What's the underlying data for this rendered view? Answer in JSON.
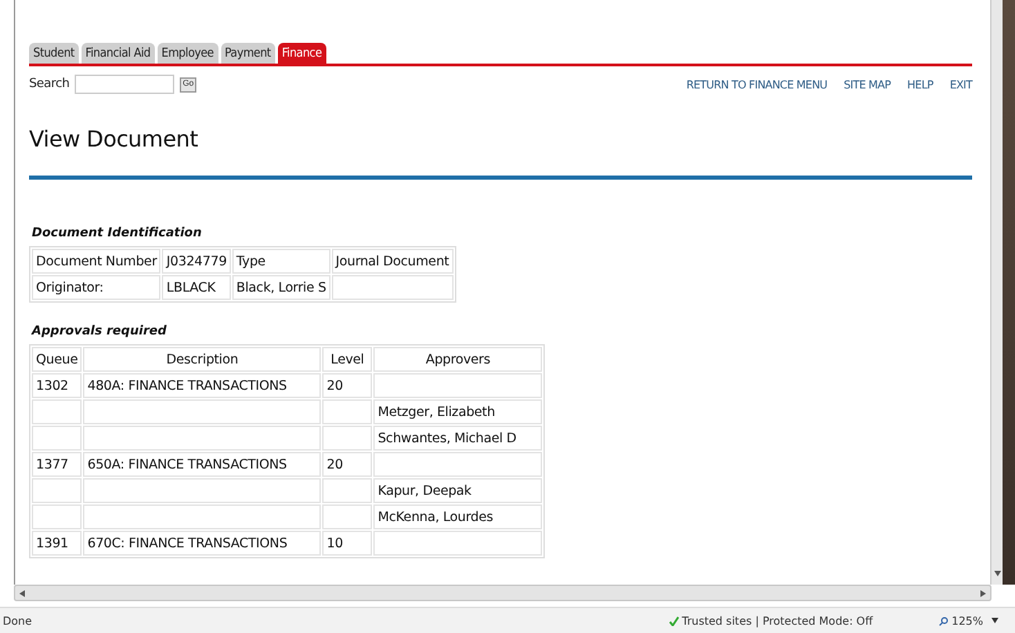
{
  "tabs": [
    {
      "label": "Student",
      "selected": false
    },
    {
      "label": "Financial Aid",
      "selected": false
    },
    {
      "label": "Employee",
      "selected": false
    },
    {
      "label": "Payment",
      "selected": false
    },
    {
      "label": "Finance",
      "selected": true
    }
  ],
  "search": {
    "label": "Search",
    "button": "Go"
  },
  "top_links": [
    "RETURN TO FINANCE MENU",
    "SITE MAP",
    "HELP",
    "EXIT"
  ],
  "page_title": "View Document",
  "document_identification": {
    "heading": "Document Identification",
    "rows": [
      [
        "Document Number",
        "J0324779",
        "Type",
        "Journal Document"
      ],
      [
        "Originator:",
        "LBLACK",
        "Black, Lorrie S",
        ""
      ]
    ]
  },
  "approvals": {
    "heading": "Approvals required",
    "columns": [
      "Queue",
      "Description",
      "Level",
      "Approvers"
    ],
    "rows": [
      [
        "1302",
        "480A: FINANCE TRANSACTIONS",
        "20",
        ""
      ],
      [
        "",
        "",
        "",
        "Metzger, Elizabeth"
      ],
      [
        "",
        "",
        "",
        "Schwantes, Michael D"
      ],
      [
        "1377",
        "650A: FINANCE TRANSACTIONS",
        "20",
        ""
      ],
      [
        "",
        "",
        "",
        "Kapur, Deepak"
      ],
      [
        "",
        "",
        "",
        "McKenna, Lourdes"
      ],
      [
        "1391",
        "670C: FINANCE TRANSACTIONS",
        "10",
        ""
      ]
    ]
  },
  "status_bar": {
    "status": "Done",
    "zone": "Trusted sites | Protected Mode: Off",
    "zoom": "125%"
  }
}
